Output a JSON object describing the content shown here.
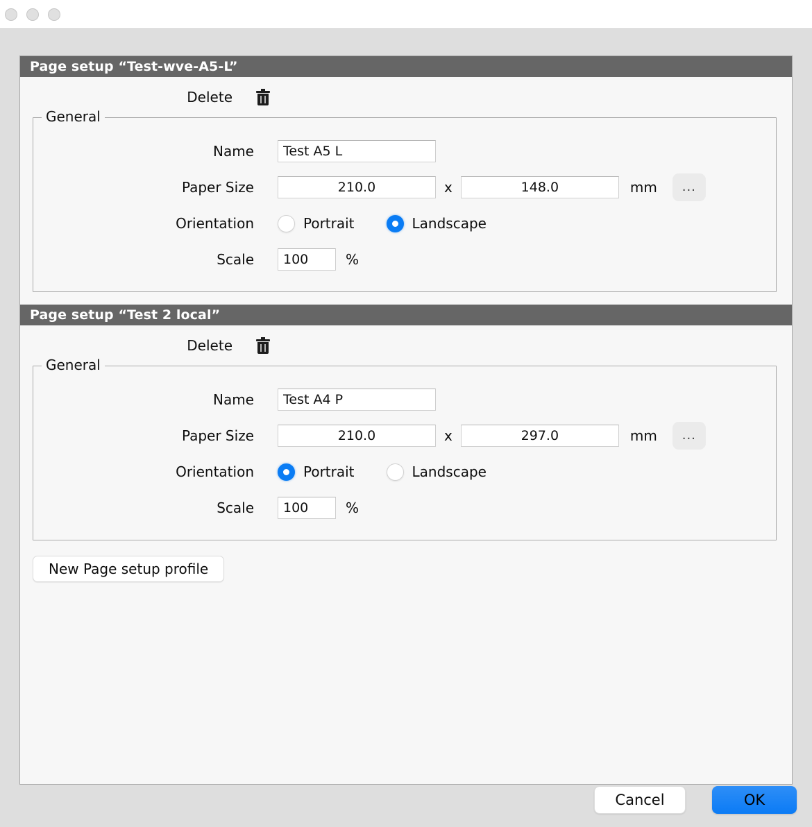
{
  "window": {
    "controls": [
      "close-button",
      "minimize-button",
      "zoom-button"
    ]
  },
  "sections": [
    {
      "header": "Page setup “Test-wve-A5-L”",
      "delete_label": "Delete",
      "delete_icon": "trash-icon",
      "group_legend": "General",
      "name_label": "Name",
      "name_value": "Test A5 L",
      "paper_label": "Paper Size",
      "paper_width": "210.0",
      "paper_x": "x",
      "paper_height": "148.0",
      "paper_unit": "mm",
      "more_button": "...",
      "orientation_label": "Orientation",
      "orientation_portrait": "Portrait",
      "orientation_landscape": "Landscape",
      "orientation_selected": "Landscape",
      "scale_label": "Scale",
      "scale_value": "100",
      "scale_unit": "%"
    },
    {
      "header": "Page setup “Test 2 local”",
      "delete_label": "Delete",
      "delete_icon": "trash-icon",
      "group_legend": "General",
      "name_label": "Name",
      "name_value": "Test A4 P",
      "paper_label": "Paper Size",
      "paper_width": "210.0",
      "paper_x": "x",
      "paper_height": "297.0",
      "paper_unit": "mm",
      "more_button": "...",
      "orientation_label": "Orientation",
      "orientation_portrait": "Portrait",
      "orientation_landscape": "Landscape",
      "orientation_selected": "Portrait",
      "scale_label": "Scale",
      "scale_value": "100",
      "scale_unit": "%"
    }
  ],
  "new_profile_button": "New Page setup profile",
  "footer": {
    "cancel": "Cancel",
    "ok": "OK"
  },
  "colors": {
    "accent": "#0a7cf4",
    "section_header_bg": "#666666",
    "panel_bg": "#f7f7f7",
    "window_bg": "#dedede"
  }
}
